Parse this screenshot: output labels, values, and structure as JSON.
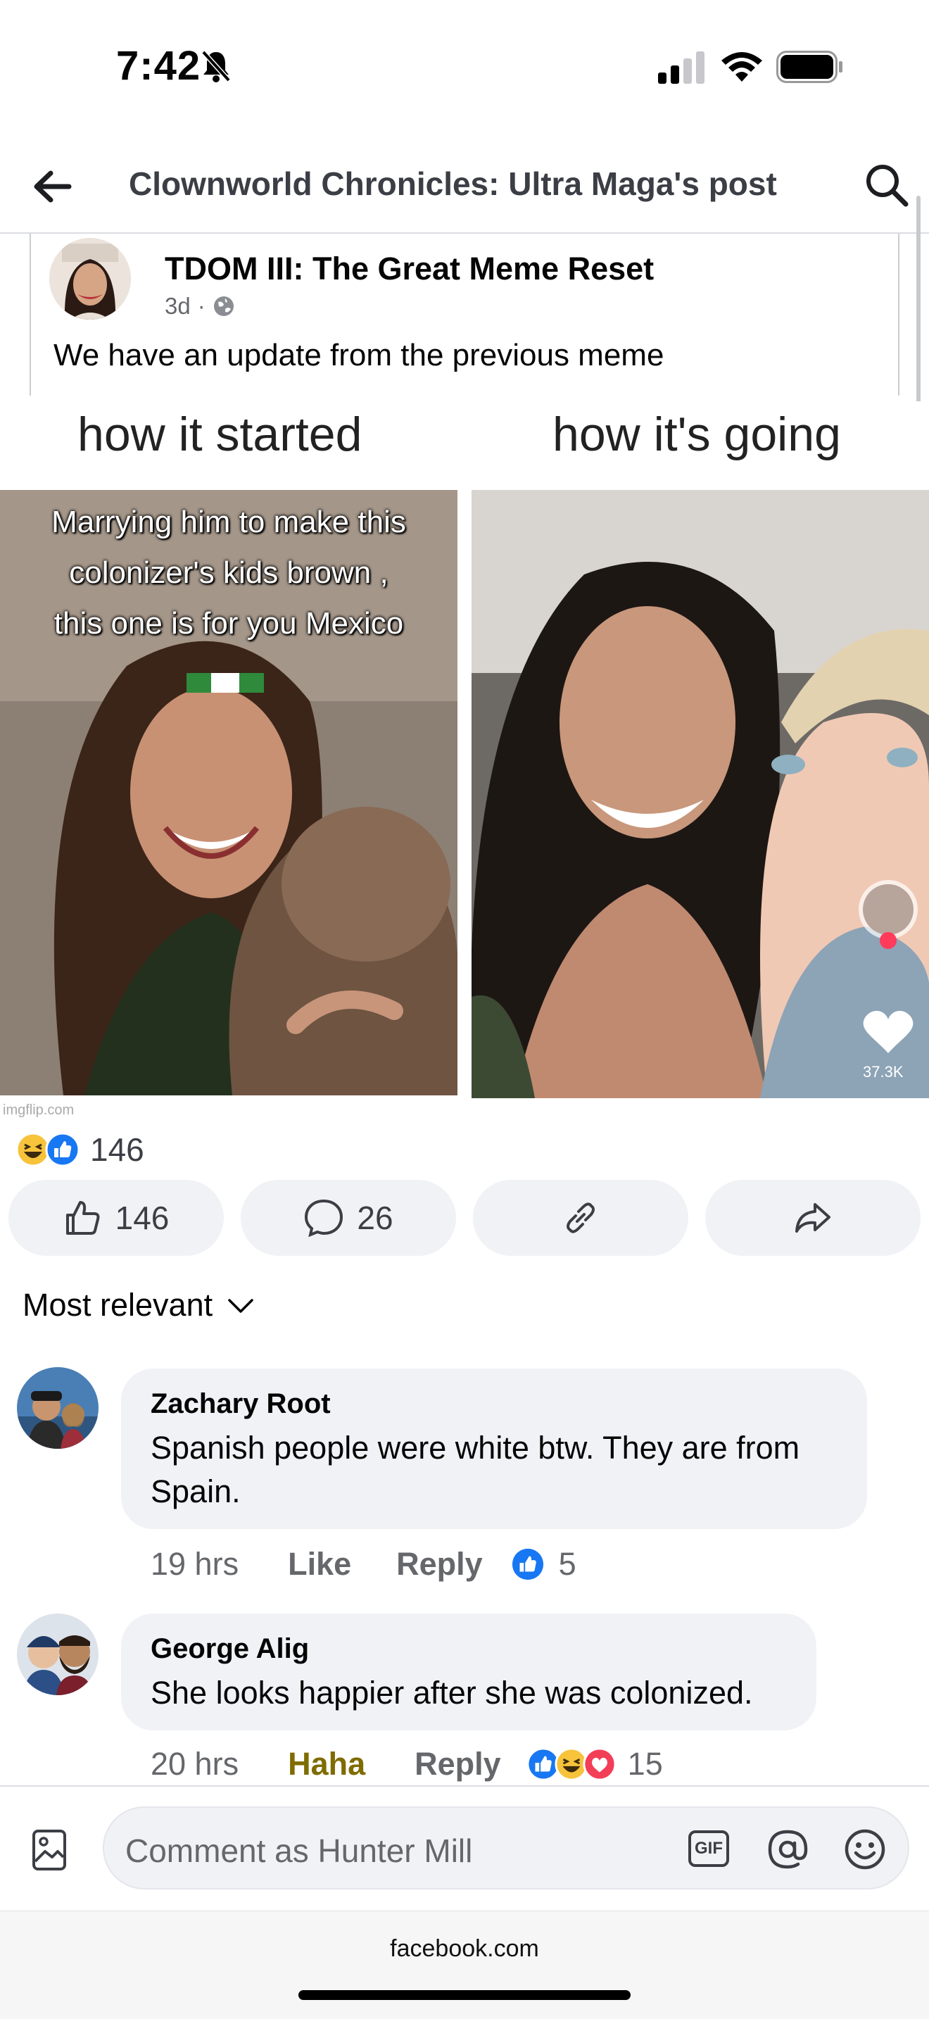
{
  "status_bar": {
    "time": "7:42",
    "signal_icon": "signal-bars-icon",
    "wifi_icon": "wifi-icon",
    "battery_icon": "battery-icon"
  },
  "header": {
    "title": "Clownworld Chronicles: Ultra Maga's post",
    "back_icon": "back-arrow-icon",
    "search_icon": "search-icon"
  },
  "shared_post": {
    "author": "TDOM III: The Great Meme Reset",
    "age": "3d",
    "separator": "·",
    "privacy_icon": "globe-icon",
    "text": "We have an update from the previous meme"
  },
  "meme": {
    "left_caption": "how it started",
    "right_caption": "how it's going",
    "overlay_lines": [
      "Marrying him to make this",
      "colonizer's kids brown ,",
      "this one is for you Mexico"
    ],
    "watermark": "imgflip.com",
    "like_count_overlay": "37.3K"
  },
  "reactions": {
    "count": "146",
    "icons": [
      "haha-icon",
      "like-icon"
    ]
  },
  "actions": {
    "like_count": "146",
    "comment_count": "26",
    "copy_link_icon": "link-icon",
    "share_icon": "share-icon"
  },
  "sort": {
    "label": "Most relevant"
  },
  "comments": [
    {
      "author": "Zachary Root",
      "text": "Spanish people were white btw. They are from Spain.",
      "time": "19 hrs",
      "like_label": "Like",
      "reply_label": "Reply",
      "reaction_count": "5"
    },
    {
      "author": "George Alig",
      "text": "She looks happier after she was colonized.",
      "time": "20 hrs",
      "like_label": "Haha",
      "reply_label": "Reply",
      "reaction_count": "15"
    }
  ],
  "composer": {
    "placeholder": "Comment as Hunter Mill",
    "gif_label": "GIF"
  },
  "browser": {
    "url": "facebook.com"
  },
  "colors": {
    "haha": "#7f6c00",
    "like_blue": "#1877f2",
    "bubble": "#f0f2f5"
  }
}
